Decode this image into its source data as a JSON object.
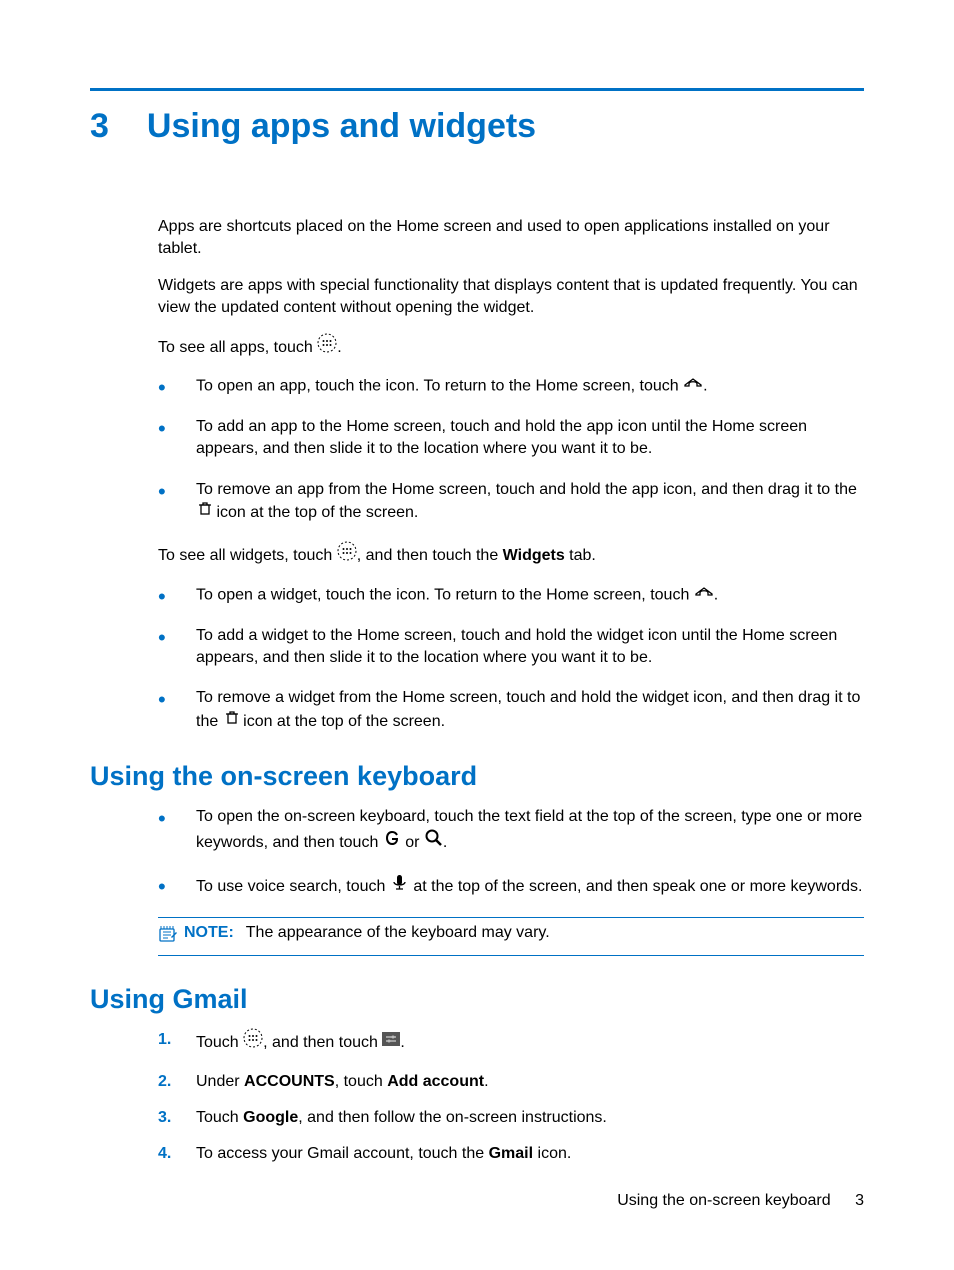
{
  "chapter": {
    "number": "3",
    "title": "Using apps and widgets"
  },
  "intro": {
    "p1": "Apps are shortcuts placed on the Home screen and used to open applications installed on your tablet.",
    "p2": "Widgets are apps with special functionality that displays content that is updated frequently. You can view the updated content without opening the widget.",
    "p3a": "To see all apps, touch ",
    "p3b": "."
  },
  "appsList": {
    "i1a": "To open an app, touch the icon. To return to the Home screen, touch ",
    "i1b": ".",
    "i2": "To add an app to the Home screen, touch and hold the app icon until the Home screen appears, and then slide it to the location where you want it to be.",
    "i3a": "To remove an app from the Home screen, touch and hold the app icon, and then drag it to the ",
    "i3b": " icon at the top of the screen."
  },
  "widgetsIntro": {
    "a": "To see all widgets, touch ",
    "b": ", and then touch the ",
    "bold": "Widgets",
    "c": " tab."
  },
  "widgetsList": {
    "i1a": "To open a widget, touch the icon. To return to the Home screen, touch ",
    "i1b": ".",
    "i2": "To add a widget to the Home screen, touch and hold the widget icon until the Home screen appears, and then slide it to the location where you want it to be.",
    "i3a": "To remove a widget from the Home screen, touch and hold the widget icon, and then drag it to the ",
    "i3b": " icon at the top of the screen."
  },
  "keyboard": {
    "heading": "Using the on-screen keyboard",
    "i1a": "To open the on-screen keyboard, touch the text field at the top of the screen, type one or more keywords, and then touch ",
    "i1b": " or ",
    "i1c": ".",
    "i2a": "To use voice search, touch ",
    "i2b": " at the top of the screen, and then speak one or more keywords."
  },
  "note": {
    "label": "NOTE:",
    "text": "The appearance of the keyboard may vary."
  },
  "gmail": {
    "heading": "Using Gmail",
    "s1a": "Touch ",
    "s1b": ", and then touch ",
    "s1c": ".",
    "s2a": "Under ",
    "s2b": "ACCOUNTS",
    "s2c": ", touch ",
    "s2d": "Add account",
    "s2e": ".",
    "s3a": "Touch ",
    "s3b": "Google",
    "s3c": ", and then follow the on-screen instructions.",
    "s4a": "To access your Gmail account, touch the ",
    "s4b": "Gmail",
    "s4c": " icon."
  },
  "footer": {
    "text": "Using the on-screen keyboard",
    "page": "3"
  }
}
